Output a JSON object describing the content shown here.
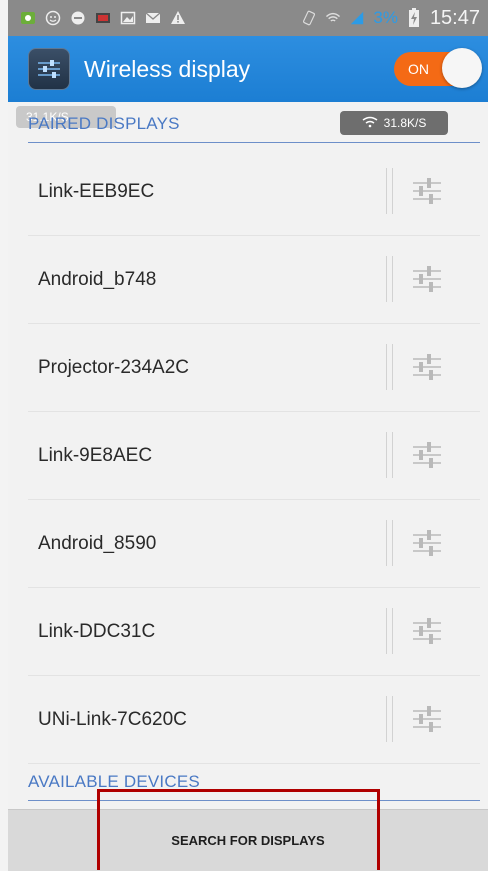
{
  "status_bar": {
    "battery_percent": "3%",
    "time": "15:47",
    "icons": [
      "android-notification-icon",
      "smiley-icon",
      "location-icon",
      "media-icon",
      "image-icon",
      "mail-icon",
      "warning-icon",
      "vibrate-icon",
      "wifi-icon",
      "signal-icon",
      "battery-charging-icon"
    ]
  },
  "app_bar": {
    "title": "Wireless display",
    "toggle_label": "ON",
    "toggle_color": "#f46a15",
    "bar_color": "#1c7ed3"
  },
  "speed_overlays": {
    "left": "31.1K/S",
    "right": "31.8K/S"
  },
  "paired_section": {
    "header": "PAIRED DISPLAYS",
    "devices": [
      "Link-EEB9EC",
      "Android_b748",
      "Projector-234A2C",
      "Link-9E8AEC",
      "Android_8590",
      "Link-DDC31C",
      "UNi-Link-7C620C"
    ]
  },
  "available_section": {
    "header": "AVAILABLE DEVICES"
  },
  "bottom": {
    "search_label": "SEARCH FOR DISPLAYS"
  }
}
